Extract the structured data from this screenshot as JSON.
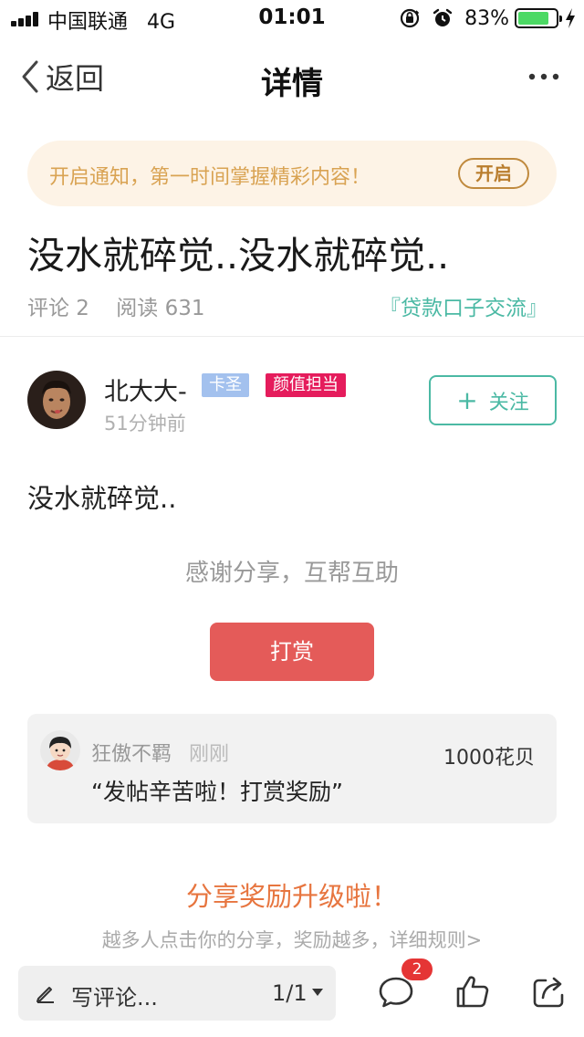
{
  "status_bar": {
    "carrier": "中国联通",
    "network": "4G",
    "time": "01:01",
    "battery_percent": "83%",
    "battery_level": 0.83,
    "icons": [
      "signal-icon",
      "orientation-lock-icon",
      "alarm-icon",
      "battery-icon",
      "charging-icon"
    ]
  },
  "nav": {
    "back_label": "返回",
    "title": "详情",
    "more_icon": "more-dots-icon"
  },
  "notice": {
    "text": "开启通知，第一时间掌握精彩内容！",
    "button_label": "开启"
  },
  "post": {
    "title": "没水就碎觉..没水就碎觉..",
    "comments_label": "评论 2",
    "reads_label": "阅读 631",
    "category": "『贷款口子交流』",
    "body": "没水就碎觉.."
  },
  "author": {
    "name": "北大大-",
    "badges": [
      "卡圣",
      "颜值担当"
    ],
    "time": "51分钟前",
    "follow_label": "关注"
  },
  "reward": {
    "thanks_text": "感谢分享，互帮互助",
    "button_label": "打赏",
    "records": [
      {
        "name": "狂傲不羁",
        "time": "刚刚",
        "amount": "1000花贝",
        "message": "“发帖辛苦啦！打赏奖励”"
      }
    ]
  },
  "share": {
    "title": "分享奖励升级啦！",
    "subtitle": "越多人点击你的分享，奖励越多，详细规则>"
  },
  "action_bar": {
    "comment_placeholder": "写评论...",
    "page_indicator": "1/1",
    "comment_count": "2",
    "icons": [
      "pencil-icon",
      "comment-icon",
      "like-icon",
      "share-icon"
    ]
  },
  "colors": {
    "accent_green": "#4bb9a4",
    "reward_red": "#e45b59",
    "notice_bg": "#fdf3e6",
    "notice_text": "#d9a353",
    "share_orange": "#e7753f",
    "badge_blue": "#a3c1ee",
    "badge_pink": "#e51c5c",
    "count_red": "#e53535"
  }
}
